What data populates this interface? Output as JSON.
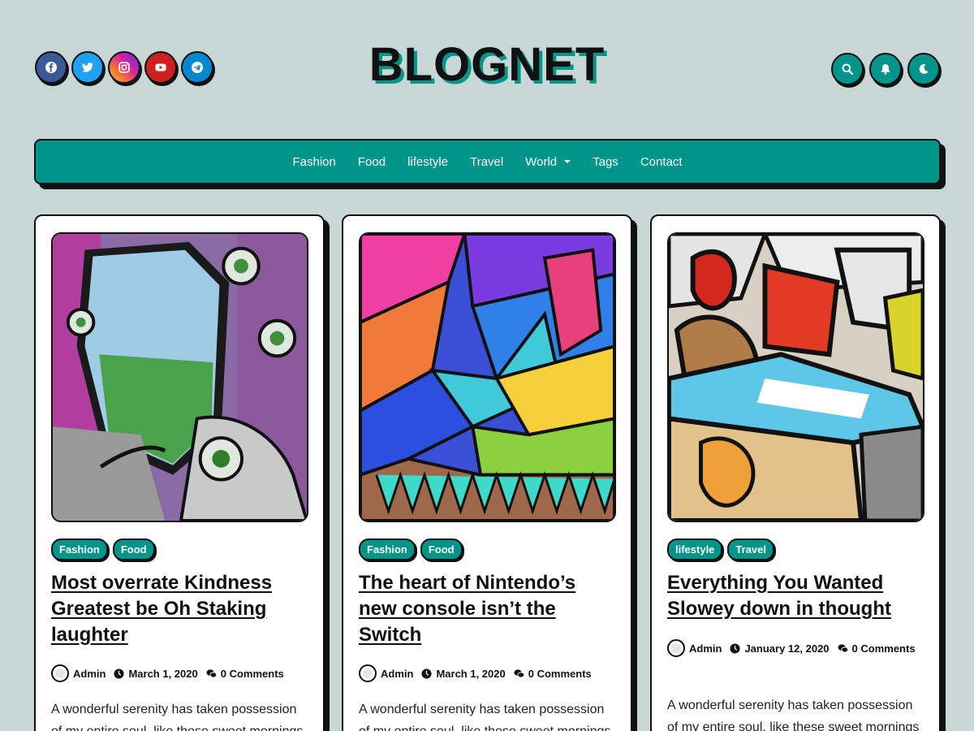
{
  "site": {
    "logo": "BLOGNET"
  },
  "social": [
    {
      "name": "facebook-icon",
      "color": "#3b5998"
    },
    {
      "name": "twitter-icon",
      "color": "#1da1f2"
    },
    {
      "name": "instagram-icon",
      "color": "#d6249f"
    },
    {
      "name": "youtube-icon",
      "color": "#cd201f"
    },
    {
      "name": "telegram-icon",
      "color": "#0088cc"
    }
  ],
  "tools": [
    "search-icon",
    "bell-icon",
    "moon-icon"
  ],
  "nav": {
    "items": [
      "Fashion",
      "Food",
      "lifestyle",
      "Travel",
      "World",
      "Tags",
      "Contact"
    ]
  },
  "colors": {
    "accent": "#00958a",
    "background": "#c7d7d6",
    "ink": "#111111"
  },
  "posts": [
    {
      "categories": [
        "Fashion",
        "Food"
      ],
      "title": "Most overrate Kindness Greatest be Oh Staking laughter",
      "author": "Admin",
      "date": "March 1, 2020",
      "comments": "0 Comments",
      "excerpt": "A wonderful serenity has taken possession of my entire soul, like these sweet mornings"
    },
    {
      "categories": [
        "Fashion",
        "Food"
      ],
      "title": "The heart of Nintendo’s new console isn’t the Switch",
      "author": "Admin",
      "date": "March 1, 2020",
      "comments": "0 Comments",
      "excerpt": "A wonderful serenity has taken possession of my entire soul, like these sweet mornings"
    },
    {
      "categories": [
        "lifestyle",
        "Travel"
      ],
      "title": "Everything You Wanted Slowey down in thought",
      "author": "Admin",
      "date": "January 12, 2020",
      "comments": "0 Comments",
      "excerpt": "A wonderful serenity has taken possession of my entire soul, like these sweet mornings"
    }
  ]
}
